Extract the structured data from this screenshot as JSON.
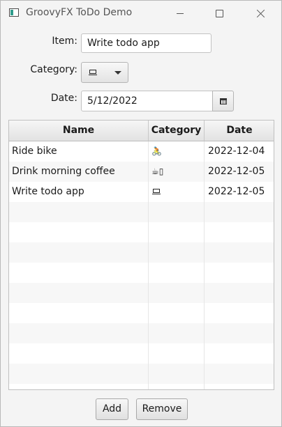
{
  "window": {
    "title": "GroovyFX ToDo Demo"
  },
  "form": {
    "item_label": "Item:",
    "item_value": "Write todo app",
    "category_label": "Category:",
    "category_selected_icon": "laptop-icon",
    "date_label": "Date:",
    "date_value": "5/12/2022"
  },
  "table": {
    "columns": [
      "Name",
      "Category",
      "Date"
    ],
    "rows": [
      {
        "name": "Ride bike",
        "category": "🚴",
        "category_icon": "bicycle-icon",
        "date": "2022-12-04"
      },
      {
        "name": "Drink morning coffee",
        "category": "☕▯",
        "category_icon": "coffee-icon",
        "date": "2022-12-05"
      },
      {
        "name": "Write todo app",
        "category": "",
        "category_icon": "laptop-icon",
        "date": "2022-12-05"
      }
    ]
  },
  "buttons": {
    "add": "Add",
    "remove": "Remove"
  }
}
